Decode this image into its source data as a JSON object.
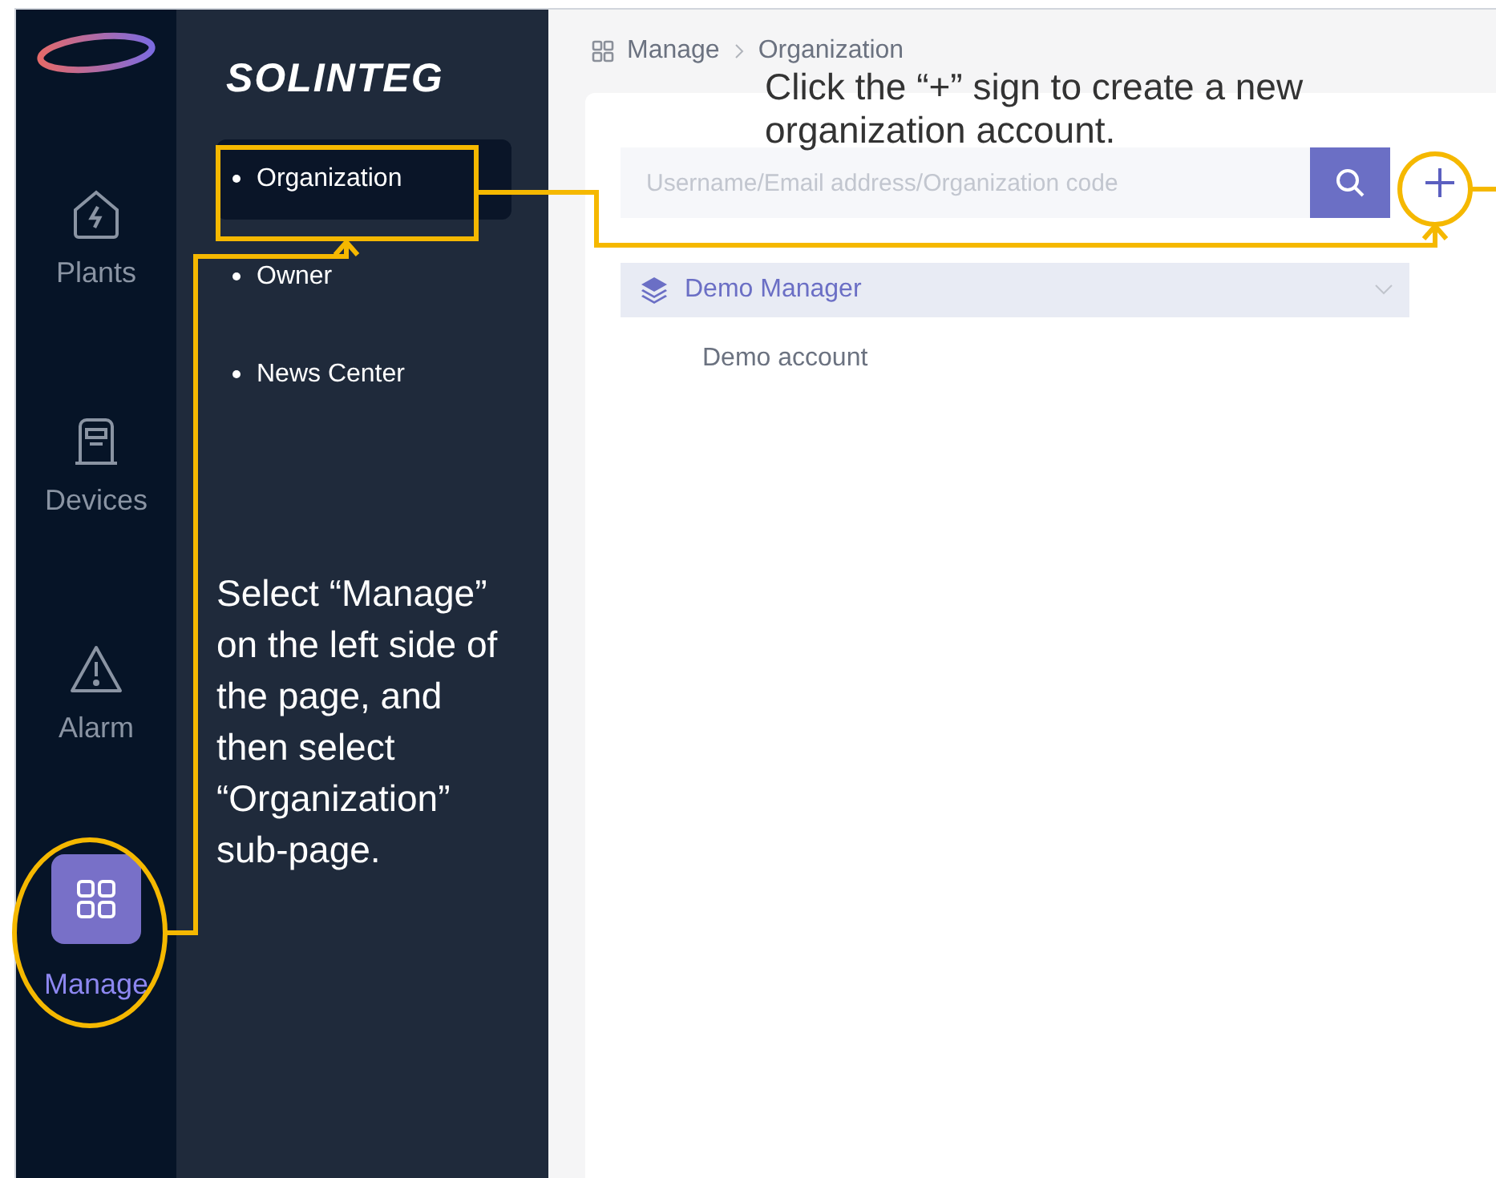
{
  "logo": {
    "text": "SOLINTEG"
  },
  "rail": [
    {
      "label": "Plants",
      "selected": false
    },
    {
      "label": "Devices",
      "selected": false
    },
    {
      "label": "Alarm",
      "selected": false
    },
    {
      "label": "Manage",
      "selected": true
    }
  ],
  "submenu": [
    {
      "label": "Organization",
      "selected": true
    },
    {
      "label": "Owner",
      "selected": false
    },
    {
      "label": "News Center",
      "selected": false
    }
  ],
  "breadcrumb": [
    "Manage",
    "Organization"
  ],
  "search": {
    "placeholder": "Username/Email address/Organization code"
  },
  "tree": [
    {
      "label": "Demo Manager",
      "expanded": true,
      "children": [
        {
          "label": "Demo account"
        }
      ]
    }
  ],
  "annotations": [
    {
      "kind": "top",
      "text": "Click the “+” sign to create a new organization account."
    },
    {
      "kind": "left",
      "text": "Select “Manage” on the left side of the page, and then select “Organization” sub-page."
    }
  ]
}
